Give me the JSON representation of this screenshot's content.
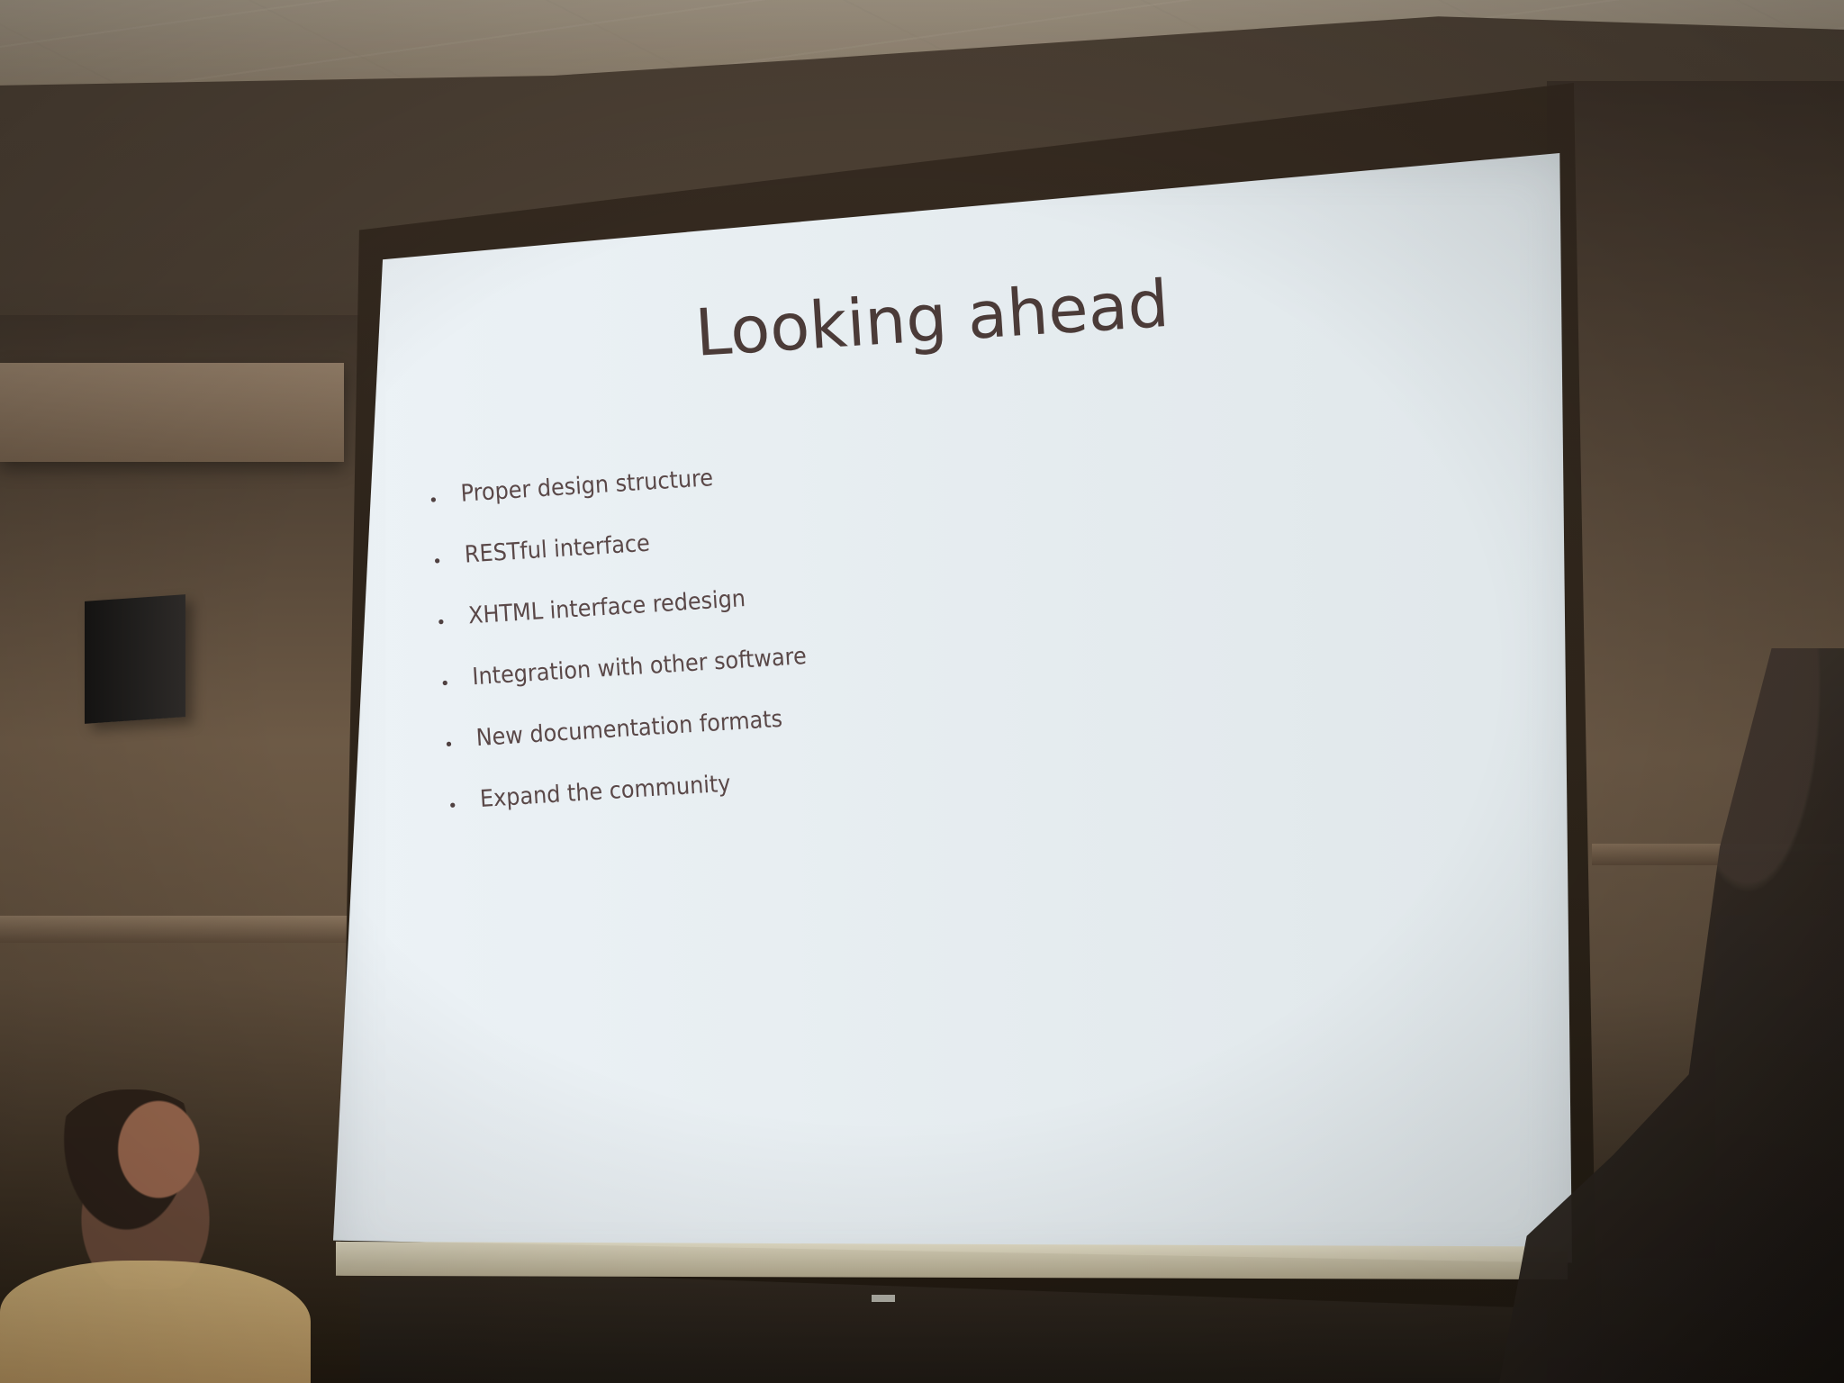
{
  "slide": {
    "title": "Looking ahead",
    "bullets": [
      "Proper design structure",
      "RESTful interface",
      "XHTML interface redesign",
      "Integration with other software",
      "New documentation formats",
      "Expand the community"
    ]
  },
  "colors": {
    "slide_text": "#4b3b38",
    "screen": "#e8edf0",
    "room": "#5e4c3b"
  }
}
